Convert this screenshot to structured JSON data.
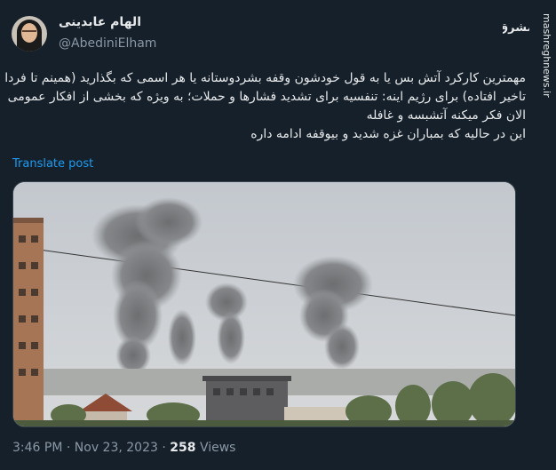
{
  "author": {
    "display_name": "الهام عابدینی",
    "handle": "@AbediniElham"
  },
  "watermark": {
    "logo_text": "مشرق",
    "side_text": "mashreghnews.ir"
  },
  "tweet": {
    "lines": [
      "مهمترین کارکرد آتش بس یا به قول خودشون وقفه بشردوستانه یا هر اسمی که بگذارید (همینم تا فردا به",
      "تاخیر افتاده) برای رژیم اینه: تنفسیه برای تشدید فشارها و حملات؛ به ویژه که بخشی از افکار عمومی",
      "الان فکر میکنه آتشبسه و غافله",
      "این در حالیه که بمباران غزه شدید و بیوقفه ادامه داره"
    ],
    "translate_label": "Translate post"
  },
  "meta": {
    "time": "3:46 PM",
    "separator": "·",
    "date": "Nov 23, 2023",
    "separator2": "·",
    "views_count": "258",
    "views_label": "Views"
  },
  "colors": {
    "background": "#15202b",
    "text": "#e7e9ea",
    "muted": "#8b98a5",
    "link": "#1d9bf0"
  },
  "icons": [
    "avatar",
    "mashregh-logo-icon"
  ]
}
